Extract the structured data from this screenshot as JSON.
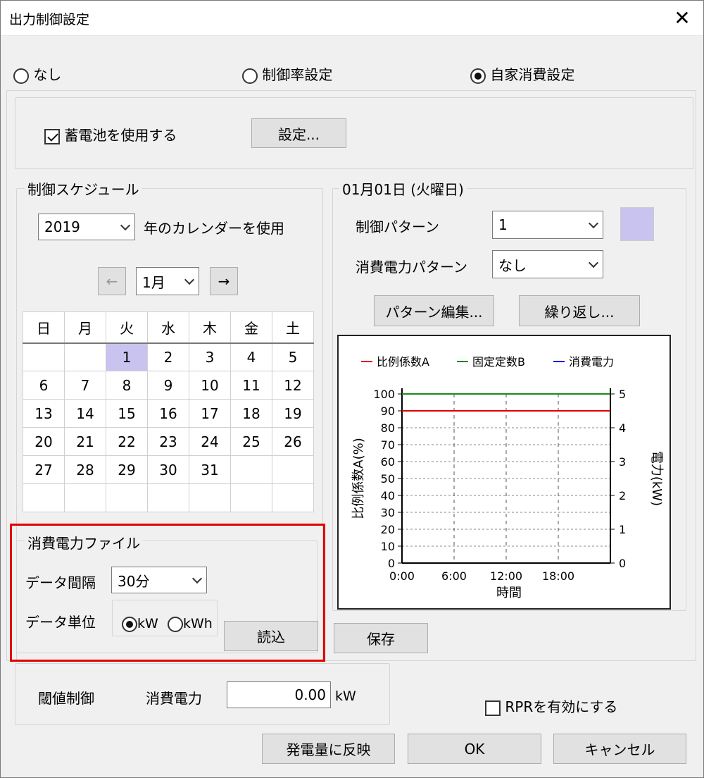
{
  "window": {
    "title": "出力制御設定"
  },
  "mode_options": [
    {
      "label": "なし",
      "selected": false
    },
    {
      "label": "制御率設定",
      "selected": false
    },
    {
      "label": "自家消費設定",
      "selected": true
    }
  ],
  "battery": {
    "checkbox_label": "蓄電池を使用する",
    "checked": true,
    "settings_button": "設定..."
  },
  "schedule": {
    "group_title": "制御スケジュール",
    "year": "2019",
    "year_suffix": "年のカレンダーを使用",
    "prev_button": "←",
    "month": "1月",
    "next_button": "→",
    "weekdays": [
      "日",
      "月",
      "火",
      "水",
      "木",
      "金",
      "土"
    ],
    "weeks": [
      [
        "",
        "",
        "1",
        "2",
        "3",
        "4",
        "5"
      ],
      [
        "6",
        "7",
        "8",
        "9",
        "10",
        "11",
        "12"
      ],
      [
        "13",
        "14",
        "15",
        "16",
        "17",
        "18",
        "19"
      ],
      [
        "20",
        "21",
        "22",
        "23",
        "24",
        "25",
        "26"
      ],
      [
        "27",
        "28",
        "29",
        "30",
        "31",
        "",
        ""
      ],
      [
        "",
        "",
        "",
        "",
        "",
        "",
        ""
      ]
    ],
    "selected_day": "1"
  },
  "day_panel": {
    "group_title": "01月01日 (火曜日)",
    "control_pattern_label": "制御パターン",
    "control_pattern_value": "1",
    "pattern_color": "#c8c3ef",
    "consumption_pattern_label": "消費電力パターン",
    "consumption_pattern_value": "なし",
    "edit_button": "パターン編集...",
    "repeat_button": "繰り返し..."
  },
  "consumption_file": {
    "group_title": "消費電力ファイル",
    "interval_label": "データ間隔",
    "interval_value": "30分",
    "unit_label": "データ単位",
    "unit_options": [
      {
        "label": "kW",
        "selected": true
      },
      {
        "label": "kWh",
        "selected": false
      }
    ],
    "load_button": "読込",
    "save_button": "保存"
  },
  "threshold": {
    "label": "閾値制御",
    "power_label": "消費電力",
    "power_value": "0.00",
    "unit": "kW"
  },
  "rpr": {
    "label": "RPRを有効にする",
    "checked": false
  },
  "footer": {
    "apply_button": "発電量に反映",
    "ok_button": "OK",
    "cancel_button": "キャンセル"
  },
  "chart_data": {
    "type": "line",
    "legend": [
      "比例係数A",
      "固定定数B",
      "消費電力"
    ],
    "colors": {
      "比例係数A": "#e00000",
      "固定定数B": "#1a8a1a",
      "消費電力": "#0000dd"
    },
    "xlabel": "時間",
    "ylabel_left": "比例係数A(%)",
    "ylabel_right": "電力(kW)",
    "x_ticks": [
      "0:00",
      "6:00",
      "12:00",
      "18:00"
    ],
    "y_left_ticks": [
      "0",
      "10",
      "20",
      "30",
      "40",
      "50",
      "60",
      "70",
      "80",
      "90",
      "100"
    ],
    "y_right_ticks": [
      "0",
      "1",
      "2",
      "3",
      "4",
      "5"
    ],
    "ylim_left": [
      0,
      100
    ],
    "ylim_right": [
      0,
      5
    ],
    "series": [
      {
        "name": "比例係数A",
        "axis": "left",
        "x": [
          0,
          24
        ],
        "values": [
          90,
          90
        ]
      },
      {
        "name": "固定定数B",
        "axis": "left",
        "x": [
          0,
          24
        ],
        "values": [
          100,
          100
        ]
      }
    ]
  }
}
